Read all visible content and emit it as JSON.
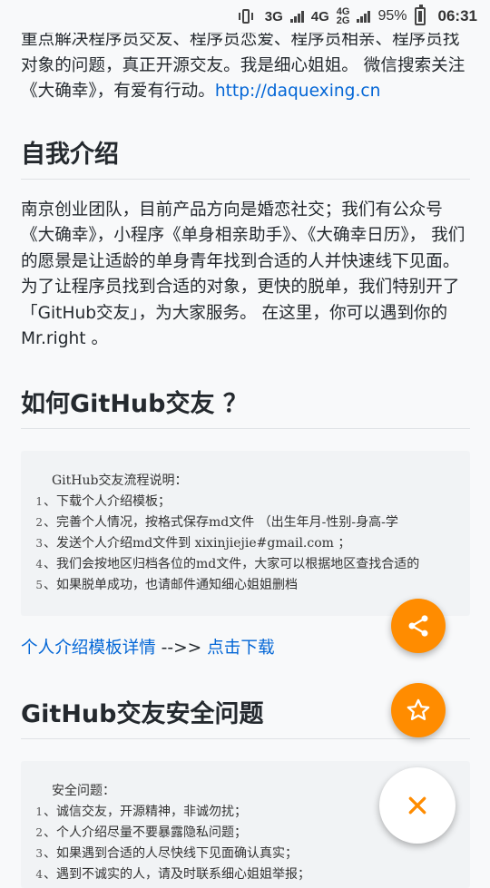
{
  "status_bar": {
    "network_3g": "3G",
    "network_4g": "4G",
    "network_4g_small": "4G",
    "network_2g_small": "2G",
    "battery_percent": "95%",
    "time": "06:31"
  },
  "intro_para": {
    "text": "重点解决程序员交友、程序员恋爱、程序员相亲、程序员找对象的问题，真正开源交友。我是细心姐姐。 微信搜索关注《大确幸》，有爱有行动。",
    "link": "http://daquexing.cn"
  },
  "section_self_intro": {
    "heading": "自我介绍",
    "body": "南京创业团队，目前产品方向是婚恋社交；我们有公众号《大确幸》，小程序《单身相亲助手》、《大确幸日历》， 我们的愿景是让适龄的单身青年找到合适的人并快速线下见面。 为了让程序员找到合适的对象，更快的脱单，我们特别开了 「GitHub交友」，为大家服务。 在这里，你可以遇到你的Mr.right 。"
  },
  "section_howto": {
    "heading": "如何GitHub交友 ？",
    "code_title": "GitHub交友流程说明：",
    "code_lines": [
      {
        "num": "1",
        "text": "、下载个人介绍模板；"
      },
      {
        "num": "2",
        "text": "、完善个人情况，按格式保存md文件 （出生年月-性别-身高-学"
      },
      {
        "num": "3",
        "text": "、发送个人介绍md文件到 xixinjiejie#gmail.com ；"
      },
      {
        "num": "4",
        "text": "、我们会按地区归档各位的md文件，大家可以根据地区查找合适的"
      },
      {
        "num": "5",
        "text": "、如果脱单成功，也请邮件通知细心姐姐删档"
      }
    ],
    "link_detail": "个人介绍模板详情",
    "arrow": " -->> ",
    "link_download": "点击下载"
  },
  "section_safety": {
    "heading": "GitHub交友安全问题",
    "code_title": "安全问题：",
    "code_lines": [
      {
        "num": "1",
        "text": "、诚信交友，开源精神，非诚勿扰；"
      },
      {
        "num": "2",
        "text": "、个人介绍尽量不要暴露隐私问题；"
      },
      {
        "num": "3",
        "text": "、如果遇到合适的人尽快线下见面确认真实；"
      },
      {
        "num": "4",
        "text": "、遇到不诚实的人，请及时联系细心姐姐举报；"
      }
    ]
  },
  "fabs": {
    "share_icon": "share-icon",
    "star_icon": "star-icon",
    "close_icon": "close-icon",
    "accent_color": "#ff8c00"
  }
}
